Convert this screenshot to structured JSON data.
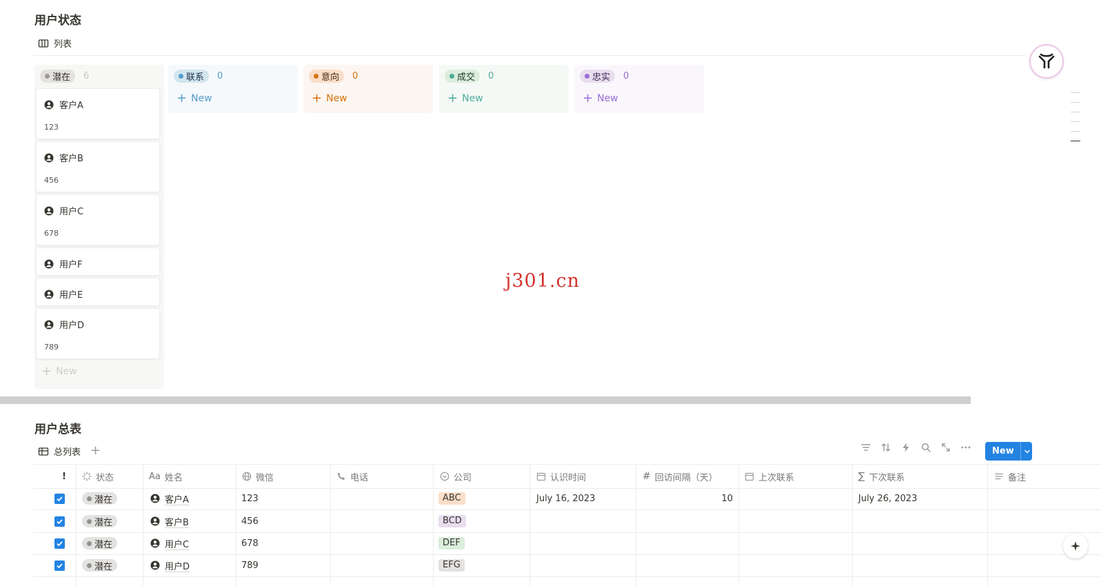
{
  "board_section": {
    "title": "用户状态",
    "view_tab": "列表",
    "columns": [
      {
        "label": "潜在",
        "count": "6",
        "color": "#9b9a97",
        "tag_bg": "#e3e2e0",
        "bg": "#f7f7f5",
        "text": "#32302c"
      },
      {
        "label": "联系",
        "count": "0",
        "color": "#529cca",
        "tag_bg": "#d3e5ef",
        "bg": "#f5f9fc",
        "text": "#183347"
      },
      {
        "label": "意向",
        "count": "0",
        "color": "#d9730d",
        "tag_bg": "#fadec9",
        "bg": "#fcf6f2",
        "text": "#49290e"
      },
      {
        "label": "成交",
        "count": "0",
        "color": "#4dab9a",
        "tag_bg": "#dbeddb",
        "bg": "#f5f9f6",
        "text": "#1c3829"
      },
      {
        "label": "忠实",
        "count": "0",
        "color": "#9a6dd7",
        "tag_bg": "#e8deee",
        "bg": "#f9f7fc",
        "text": "#412454"
      }
    ],
    "new_label": "New",
    "cards": [
      {
        "title": "客户A",
        "sub": "123"
      },
      {
        "title": "客户B",
        "sub": "456"
      },
      {
        "title": "用户C",
        "sub": "678"
      },
      {
        "title": "用户F",
        "sub": ""
      },
      {
        "title": "用户E",
        "sub": ""
      },
      {
        "title": "用户D",
        "sub": "789"
      }
    ]
  },
  "watermark": "j301.cn",
  "table_section": {
    "title": "用户总表",
    "view_tab": "总列表",
    "new_button": "New",
    "headers": {
      "flag": "!",
      "status": "状态",
      "name": "姓名",
      "wechat": "微信",
      "phone": "电话",
      "company": "公司",
      "met": "认识时间",
      "interval": "回访间隔（天）",
      "last": "上次联系",
      "next": "下次联系",
      "note": "备注"
    },
    "name_prefix": "Aa",
    "rows": [
      {
        "status": "潜在",
        "name": "客户A",
        "wechat": "123",
        "company": "ABC",
        "company_bg": "#fadec9",
        "met": "July 16, 2023",
        "interval": "10",
        "next": "July 26, 2023"
      },
      {
        "status": "潜在",
        "name": "客户B",
        "wechat": "456",
        "company": "BCD",
        "company_bg": "#e8deee",
        "met": "",
        "interval": "",
        "next": ""
      },
      {
        "status": "潜在",
        "name": "用户C",
        "wechat": "678",
        "company": "DEF",
        "company_bg": "#dbeddb",
        "met": "",
        "interval": "",
        "next": ""
      },
      {
        "status": "潜在",
        "name": "用户D",
        "wechat": "789",
        "company": "EFG",
        "company_bg": "#e3e2e0",
        "met": "",
        "interval": "",
        "next": ""
      }
    ]
  }
}
